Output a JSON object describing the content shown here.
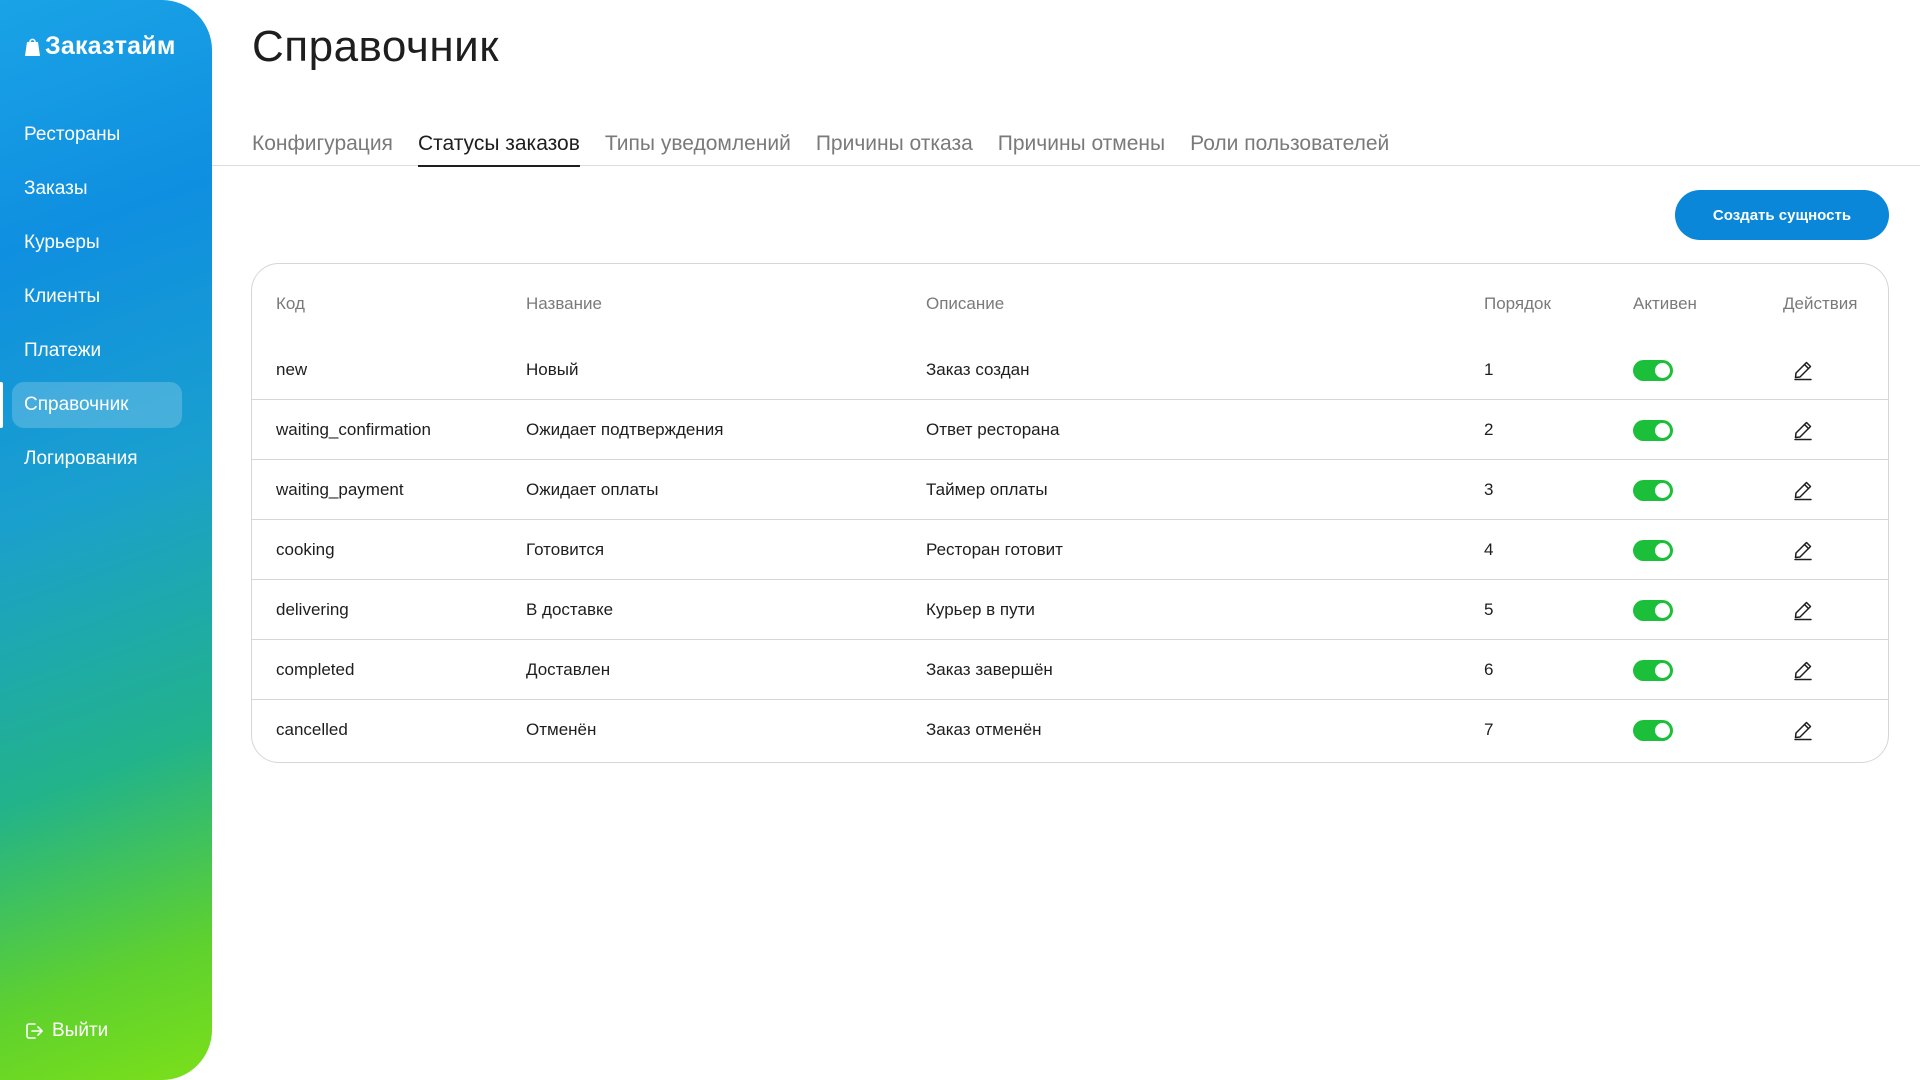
{
  "app": {
    "logo_text": "Заказтайм"
  },
  "sidebar": {
    "items": [
      {
        "label": "Рестораны",
        "active": false
      },
      {
        "label": "Заказы",
        "active": false
      },
      {
        "label": "Курьеры",
        "active": false
      },
      {
        "label": "Клиенты",
        "active": false
      },
      {
        "label": "Платежи",
        "active": false
      },
      {
        "label": "Справочник",
        "active": true
      },
      {
        "label": "Логирования",
        "active": false
      }
    ],
    "logout_label": "Выйти",
    "logout_icon": "logout-icon"
  },
  "page": {
    "title": "Справочник"
  },
  "tabs": [
    {
      "label": "Конфигурация",
      "active": false
    },
    {
      "label": "Статусы заказов",
      "active": true
    },
    {
      "label": "Типы уведомлений",
      "active": false
    },
    {
      "label": "Причины отказа",
      "active": false
    },
    {
      "label": "Причины отмены",
      "active": false
    },
    {
      "label": "Роли пользователей",
      "active": false
    }
  ],
  "toolbar": {
    "create_label": "Создать сущность"
  },
  "table": {
    "columns": {
      "code": "Код",
      "name": "Название",
      "description": "Описание",
      "order": "Порядок",
      "active": "Активен",
      "actions": "Действия"
    },
    "rows": [
      {
        "code": "new",
        "name": "Новый",
        "description": "Заказ создан",
        "order": "1",
        "active": true
      },
      {
        "code": "waiting_confirmation",
        "name": "Ожидает подтверждения",
        "description": "Ответ ресторана",
        "order": "2",
        "active": true
      },
      {
        "code": "waiting_payment",
        "name": "Ожидает оплаты",
        "description": "Таймер оплаты",
        "order": "3",
        "active": true
      },
      {
        "code": "cooking",
        "name": "Готовится",
        "description": "Ресторан готовит",
        "order": "4",
        "active": true
      },
      {
        "code": "delivering",
        "name": "В доставке",
        "description": "Курьер в пути",
        "order": "5",
        "active": true
      },
      {
        "code": "completed",
        "name": "Доставлен",
        "description": "Заказ завершён",
        "order": "6",
        "active": true
      },
      {
        "code": "cancelled",
        "name": "Отменён",
        "description": "Заказ отменён",
        "order": "7",
        "active": true
      }
    ]
  },
  "colors": {
    "accent": "#0a87d8",
    "toggle_on": "#1cbf3a",
    "text": "#1e1e1e",
    "muted": "#7a7a7a"
  }
}
